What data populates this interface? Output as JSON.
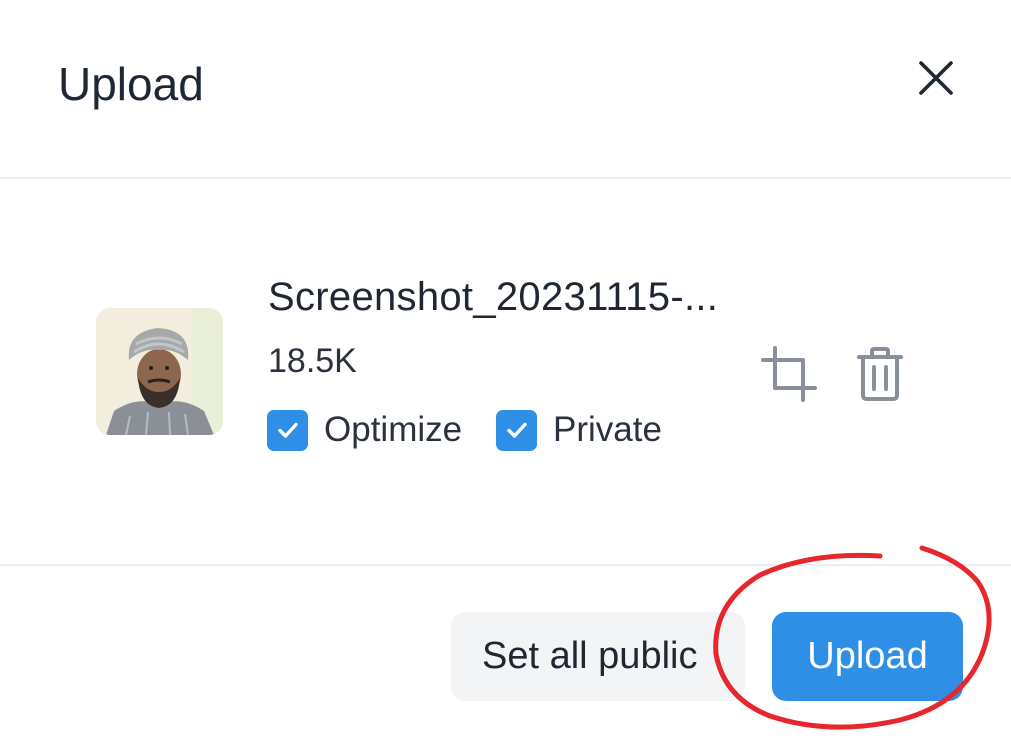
{
  "dialog": {
    "title": "Upload"
  },
  "file": {
    "name": "Screenshot_20231115-...",
    "size": "18.5K",
    "thumbnail_icon": "person-photo-thumbnail"
  },
  "options": {
    "optimize": {
      "label": "Optimize",
      "checked": true
    },
    "private": {
      "label": "Private",
      "checked": true
    }
  },
  "actions": {
    "crop_icon": "crop-icon",
    "delete_icon": "trash-icon"
  },
  "footer": {
    "set_public_label": "Set all public",
    "upload_label": "Upload"
  },
  "colors": {
    "accent": "#2f8fe6",
    "annotation": "#e8262d"
  }
}
